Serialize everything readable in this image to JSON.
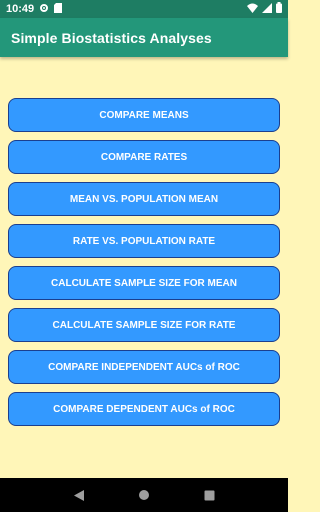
{
  "status_bar": {
    "time": "10:49",
    "icons": [
      "gear-icon",
      "sd-card-icon",
      "wifi-icon",
      "signal-icon",
      "battery-icon"
    ]
  },
  "app_bar": {
    "title": "Simple Biostatistics Analyses"
  },
  "menu": {
    "buttons": [
      {
        "label": "COMPARE MEANS"
      },
      {
        "label": "COMPARE RATES"
      },
      {
        "label": "MEAN VS. POPULATION MEAN"
      },
      {
        "label": "RATE VS. POPULATION RATE"
      },
      {
        "label": "CALCULATE SAMPLE SIZE FOR MEAN"
      },
      {
        "label": "CALCULATE SAMPLE SIZE FOR RATE"
      },
      {
        "label": "COMPARE INDEPENDENT AUCs of ROC"
      },
      {
        "label": "COMPARE DEPENDENT AUCs of ROC"
      }
    ]
  },
  "colors": {
    "status_bar": "#1e7d63",
    "app_bar": "#23977a",
    "background": "#fff6b8",
    "button": "#3399ff",
    "button_border": "#1b3f8f"
  },
  "nav_bar": {
    "icons": [
      "back-icon",
      "home-icon",
      "recents-icon"
    ]
  }
}
